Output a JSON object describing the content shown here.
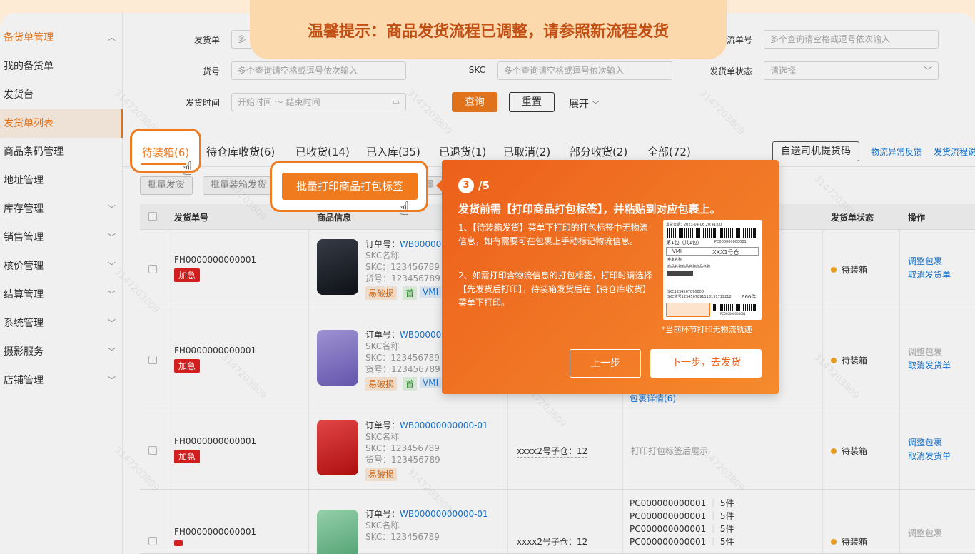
{
  "banner": {
    "text": "温馨提示：商品发货流程已调整，请参照新流程发货"
  },
  "sidebar": {
    "group_title": "备货单管理",
    "items": [
      "我的备货单",
      "发货台",
      "发货单列表",
      "商品条码管理",
      "地址管理"
    ],
    "groups": [
      "库存管理",
      "销售管理",
      "核价管理",
      "结算管理",
      "系统管理",
      "摄影服务",
      "店铺管理"
    ]
  },
  "filters": {
    "delivery_no_label": "发货单",
    "delivery_no_placeholder": "多",
    "logistics_label": "流单号",
    "logistics_placeholder": "多个查询请空格或逗号依次输入",
    "sku_label": "货号",
    "sku_placeholder": "多个查询请空格或逗号依次输入",
    "skc_label": "SKC",
    "skc_placeholder": "多个查询请空格或逗号依次输入",
    "status_label": "发货单状态",
    "status_placeholder": "请选择",
    "time_label": "发货时间",
    "time_placeholder": "开始时间 ～ 结束时间",
    "search_btn": "查询",
    "reset_btn": "重置",
    "expand_btn": "展开"
  },
  "tabs": [
    "待装箱(6)",
    "待仓库收货(6)",
    "已收货(14)",
    "已入库(35)",
    "已退货(1)",
    "已取消(2)",
    "部分收货(2)",
    "全部(72)"
  ],
  "right_actions": {
    "driver_btn": "自送司机提货码",
    "link1": "物流异常反馈",
    "link2": "发货流程说"
  },
  "toolbar": {
    "btn1": "批量发货",
    "btn2": "批量装箱发货",
    "btn3": "量",
    "highlight_btn": "批量打印商品打包标签"
  },
  "table": {
    "headers": [
      "发货单号",
      "商品信息",
      "发货单状态",
      "操作"
    ],
    "rows": [
      {
        "no": "FH0000000000001",
        "urgent": "加急",
        "order": "订单号：",
        "order_no": "WB000000",
        "skc_name": "SKC名称",
        "skc": "SKC：123456789",
        "sku": "货号：123456789",
        "tags": [
          "易破损",
          "首",
          "VMI"
        ],
        "status": "待装箱",
        "ops": [
          "调整包裹",
          "取消发货单"
        ]
      },
      {
        "no": "FH0000000000001",
        "urgent": "加急",
        "order": "订单号：",
        "order_no": "WB000000",
        "skc_name": "SKC名称",
        "skc": "SKC：123456789",
        "sku": "货号：123456789",
        "tags": [
          "易破损",
          "首",
          "VMI"
        ],
        "pack_link": "包裹详情(6)",
        "status": "待装箱",
        "ops": [
          "调整包裹",
          "取消发货单"
        ]
      },
      {
        "no": "FH0000000000001",
        "urgent": "加急",
        "order": "订单号：",
        "order_no": "WB00000000000-01",
        "skc_name": "SKC名称",
        "skc": "SKC：123456789",
        "sku": "货号：123456789",
        "tags": [
          "易破损"
        ],
        "warehouse": "xxxx2号子仓：12",
        "pack_info": "打印打包标签后展示",
        "status": "待装箱",
        "ops": [
          "调整包裹",
          "取消发货单"
        ]
      },
      {
        "no": "FH0000000000001",
        "order": "订单号：",
        "order_no": "WB00000000000-01",
        "skc_name": "SKC名称",
        "skc": "SKC：123456789",
        "warehouse": "xxxx2号子仓：12",
        "pcs": [
          "PC000000000001",
          "PC000000000001",
          "PC000000000001",
          "PC000000000001"
        ],
        "pc_qty": "5件",
        "status": "待装箱",
        "ops": [
          "调整包裹"
        ]
      }
    ]
  },
  "popup": {
    "step": "3",
    "total": "/5",
    "title": "发货前需【打印商品打包标签】，并粘贴到对应包裹上。",
    "p1": "1、【待装箱发货】菜单下打印的打包标签中无物流信息，如有需要可在包裹上手动标记物流信息。",
    "p2": "2、如需打印含物流信息的打包标签，打印时请选择【先发货后打印】，待装箱发货后在【待仓库收货】菜单下打印。",
    "note": "*当前环节打印无物流轨迹",
    "prev": "上一步",
    "next": "下一步，去发货",
    "receipt": {
      "date": "发货日期：2023-04-06 20:41:00",
      "pkg": "第1包（共1包）",
      "pc": "PC000000000001",
      "vmi": "VMI",
      "wh": "XXX1号仓",
      "merchant": "卖家名称",
      "product": "商品名称商品名称商品名称",
      "skc": "SKC1234567890000",
      "skc2": "SKC货号1234567891113151719212",
      "qty": "666件",
      "pc2": "PC000000000001"
    }
  },
  "watermark": "3147203809"
}
